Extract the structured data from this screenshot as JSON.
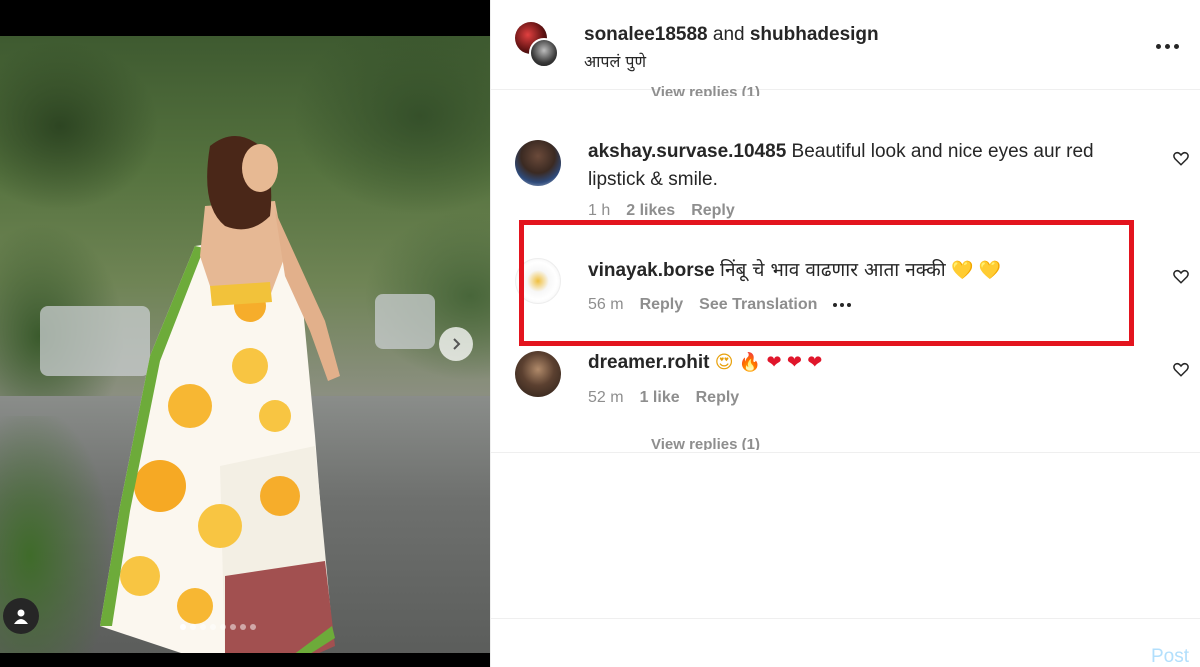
{
  "post": {
    "author": "sonalee18588",
    "connector": "and",
    "coauthor": "shubhadesign",
    "location": "आपलं पुणे",
    "carousel_count": 8,
    "carousel_active_index": 0
  },
  "comments_top": {
    "view_replies_cut": "View replies (1)"
  },
  "comments": [
    {
      "username": "akshay.survase.10485",
      "text": "Beautiful look and nice eyes aur red lipstick & smile.",
      "time": "1 h",
      "likes": "2 likes",
      "reply": "Reply"
    },
    {
      "username": "vinayak.borse",
      "text": "निंबू चे भाव वाढणार आता नक्की",
      "emojis": [
        "💛",
        "💛"
      ],
      "time": "56 m",
      "reply": "Reply",
      "translate": "See Translation",
      "highlighted": true
    },
    {
      "username": "dreamer.rohit",
      "emojis": [
        "😍",
        "🔥",
        "❤",
        "❤",
        "❤"
      ],
      "time": "52 m",
      "likes": "1 like",
      "reply": "Reply",
      "view_replies": "View replies (1)"
    }
  ],
  "footer": {
    "post_label": "Post"
  },
  "colors": {
    "highlight_border": "#e3141e",
    "text_primary": "#262626",
    "text_secondary": "#8e8e8e",
    "post_disabled": "#b2dffc"
  },
  "icons": [
    "next-arrow-icon",
    "user-tag-icon",
    "more-options-icon",
    "heart-icon"
  ]
}
